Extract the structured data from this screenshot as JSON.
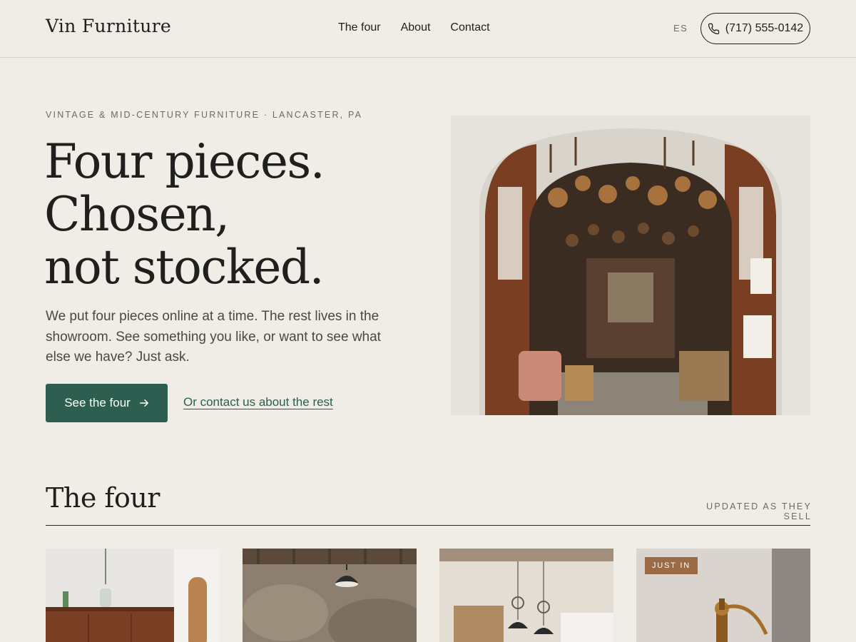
{
  "brand": {
    "name": "Vin Furniture"
  },
  "nav": {
    "items": [
      {
        "label": "The four"
      },
      {
        "label": "About"
      },
      {
        "label": "Contact"
      }
    ]
  },
  "header": {
    "language": "ES",
    "phone": "(717) 555-0142"
  },
  "hero": {
    "eyebrow": "Vintage & mid-century furniture · Lancaster, PA",
    "headline": [
      "Four pieces.",
      "Chosen,",
      "not stocked."
    ],
    "lede": "We put four pieces online at a time. The rest lives in the showroom. See something you like, or want to see what else we have? Just ask.",
    "cta_primary": "See the four",
    "cta_secondary": "Or contact us about the rest"
  },
  "section": {
    "title": "The four",
    "note": "Updated as they sell",
    "cards": [
      {
        "badge": ""
      },
      {
        "badge": ""
      },
      {
        "badge": ""
      },
      {
        "badge": "Just in"
      }
    ]
  },
  "colors": {
    "accent": "#2d5e4f",
    "badge": "#9a6b45",
    "background": "#f0ede7"
  },
  "icons": {
    "phone": "phone-icon",
    "arrow": "arrow-right-icon"
  }
}
